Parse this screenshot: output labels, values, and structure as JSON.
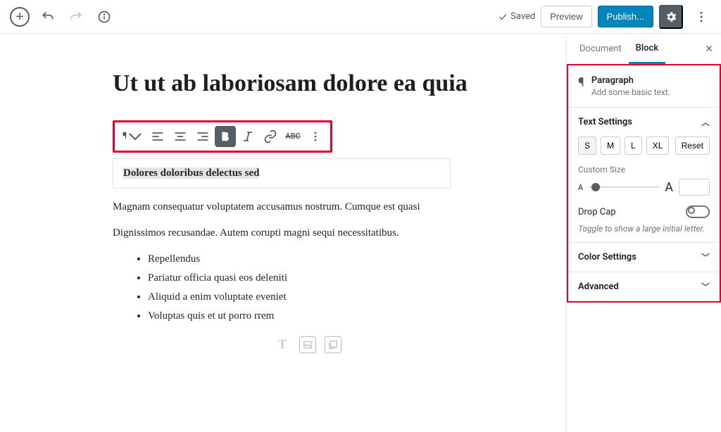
{
  "topbar": {
    "saved": "Saved",
    "preview": "Preview",
    "publish": "Publish..."
  },
  "editor": {
    "title": "Ut ut ab laboriosam dolore ea quia",
    "selected_text": "Dolores doloribus delectus sed",
    "para1": "Magnam consequatur voluptatem accusamus nostrum. Cumque est quasi",
    "para2": "Dignissimos recusandae. Autem corupti magni sequi necessitatibus.",
    "list": [
      "Repellendus",
      "Pariatur officia quasi eos deleniti",
      "Aliquid a enim voluptate eveniet",
      "Voluptas quis et ut porro rrem"
    ]
  },
  "sidebar": {
    "tabs": {
      "document": "Document",
      "block": "Block"
    },
    "block_type": {
      "name": "Paragraph",
      "desc": "Add some basic text."
    },
    "text_settings": {
      "label": "Text Settings",
      "sizes": [
        "S",
        "M",
        "L",
        "XL"
      ],
      "reset": "Reset",
      "custom_size": "Custom Size",
      "drop_cap": "Drop Cap",
      "helper": "Toggle to show a large initial letter."
    },
    "color_settings": "Color Settings",
    "advanced": "Advanced"
  }
}
